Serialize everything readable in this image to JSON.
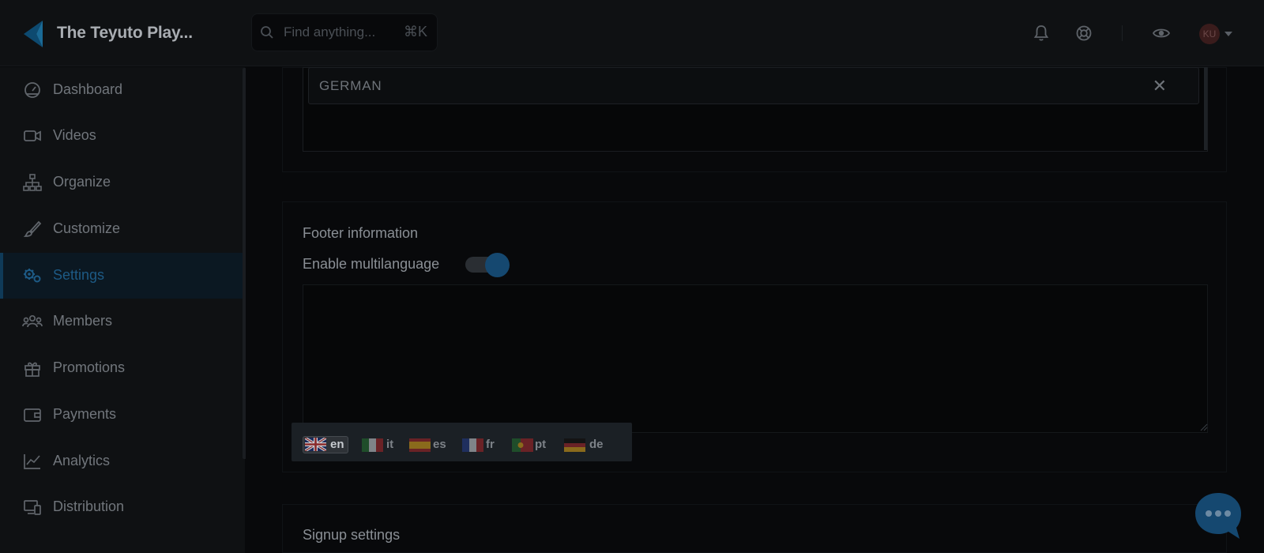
{
  "header": {
    "brand": "The Teyuto Play...",
    "search_placeholder": "Find anything...",
    "search_shortcut": "⌘K",
    "icons": [
      "bell-icon",
      "help-lifebuoy-icon",
      "eye-icon"
    ],
    "avatar_initials": "KU"
  },
  "sidebar": {
    "items": [
      {
        "label": "Dashboard",
        "icon": "speedometer-icon",
        "active": false
      },
      {
        "label": "Videos",
        "icon": "video-camera-icon",
        "active": false
      },
      {
        "label": "Organize",
        "icon": "hierarchy-icon",
        "active": false
      },
      {
        "label": "Customize",
        "icon": "brush-icon",
        "active": false
      },
      {
        "label": "Settings",
        "icon": "gears-icon",
        "active": true
      },
      {
        "label": "Members",
        "icon": "users-icon",
        "active": false
      },
      {
        "label": "Promotions",
        "icon": "gift-icon",
        "active": false
      },
      {
        "label": "Payments",
        "icon": "wallet-icon",
        "active": false
      },
      {
        "label": "Analytics",
        "icon": "line-chart-icon",
        "active": false
      },
      {
        "label": "Distribution",
        "icon": "devices-icon",
        "active": false
      }
    ]
  },
  "main": {
    "language_tag": "GERMAN",
    "footer_section_title": "Footer information",
    "multilanguage_label": "Enable multilanguage",
    "multilanguage_enabled": true,
    "signup_section_title": "Signup settings",
    "languages": [
      {
        "code": "en",
        "flag": "uk-flag-icon",
        "active": true
      },
      {
        "code": "it",
        "flag": "italy-flag-icon",
        "active": false
      },
      {
        "code": "es",
        "flag": "spain-flag-icon",
        "active": false
      },
      {
        "code": "fr",
        "flag": "france-flag-icon",
        "active": false
      },
      {
        "code": "pt",
        "flag": "portugal-flag-icon",
        "active": false
      },
      {
        "code": "de",
        "flag": "germany-flag-icon",
        "active": false
      }
    ]
  },
  "colors": {
    "accent": "#154870",
    "active_nav_text": "#1d5a85",
    "background": "#08090b"
  }
}
